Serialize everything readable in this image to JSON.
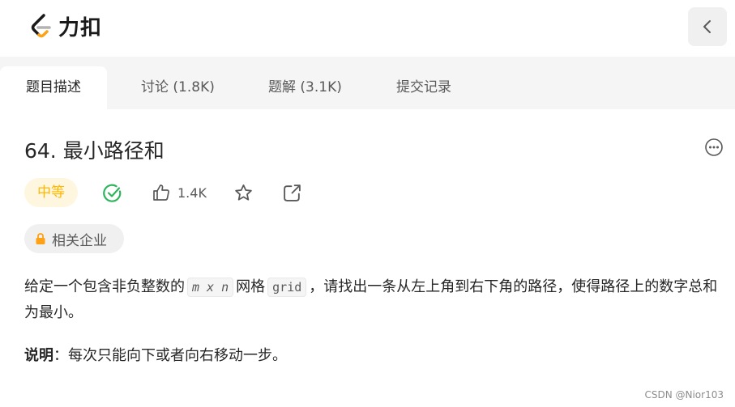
{
  "header": {
    "logo_text": "力扣",
    "back_icon": "chevron-left-icon"
  },
  "tabs": [
    {
      "label": "题目描述",
      "active": true
    },
    {
      "label": "讨论 (1.8K)"
    },
    {
      "label": "题解 (3.1K)"
    },
    {
      "label": "提交记录"
    }
  ],
  "problem": {
    "title": "64. 最小路径和",
    "difficulty": "中等",
    "likes": "1.4K",
    "company_label": "相关企业",
    "desc_part1": "给定一个包含非负整数的",
    "code_mxn": "m x n",
    "desc_part2": "网格",
    "code_grid": "grid",
    "desc_part3": "，请找出一条从左上角到右下角的路径，使得路径上的数字总和为最小。",
    "note_label": "说明",
    "note_text": "：每次只能向下或者向右移动一步。"
  },
  "watermark": "CSDN @Nior103",
  "colors": {
    "accent_orange": "#ffa116",
    "difficulty_color": "#ffb800",
    "success_green": "#2db55d"
  }
}
